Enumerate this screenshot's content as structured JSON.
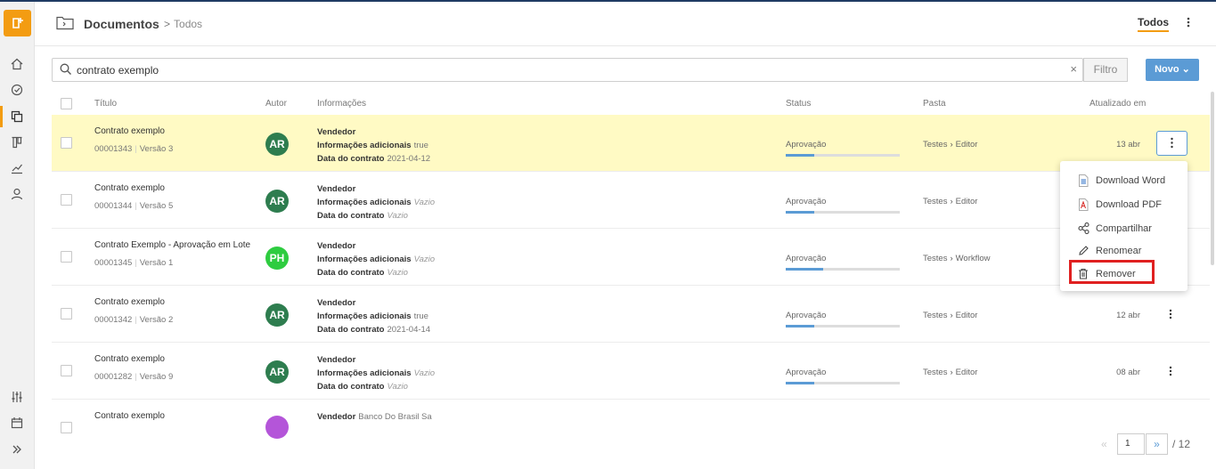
{
  "colors": {
    "accent": "#f39c12",
    "primary": "#5b9bd5",
    "highlight": "#fffac4",
    "danger": "#e02020"
  },
  "logo": {
    "glyph": "t",
    "icon": "add-document-logo"
  },
  "header": {
    "title": "Documentos",
    "breadcrumb": "Todos",
    "tab": "Todos"
  },
  "search": {
    "value": "contrato exemplo",
    "clear": "×"
  },
  "buttons": {
    "filtro": "Filtro",
    "novo": "Novo"
  },
  "columns": {
    "titulo": "Título",
    "autor": "Autor",
    "informacoes": "Informações",
    "status": "Status",
    "pasta": "Pasta",
    "atualizado": "Atualizado em"
  },
  "rows": [
    {
      "title": "Contrato exemplo",
      "code": "00001343",
      "version": "Versão 3",
      "author": "AR",
      "author_color": "#2e7d4f",
      "vendedor": "Vendedor",
      "vendedor_val": "",
      "info_label": "Informações adicionais",
      "info_val": "true",
      "data_label": "Data do contrato",
      "data_val": "2021-04-12",
      "status": "Aprovação",
      "progress": 0.25,
      "folder": "Testes",
      "subfolder": "Editor",
      "date": "13 abr"
    },
    {
      "title": "Contrato exemplo",
      "code": "00001344",
      "version": "Versão 5",
      "author": "AR",
      "author_color": "#2e7d4f",
      "vendedor": "Vendedor",
      "vendedor_val": "",
      "info_label": "Informações adicionais",
      "info_val": "Vazio",
      "data_label": "Data do contrato",
      "data_val": "Vazio",
      "status": "Aprovação",
      "progress": 0.25,
      "folder": "Testes",
      "subfolder": "Editor",
      "date": ""
    },
    {
      "title": "Contrato Exemplo - Aprovação em Lote",
      "code": "00001345",
      "version": "Versão 1",
      "author": "PH",
      "author_color": "#2ecc40",
      "vendedor": "Vendedor",
      "vendedor_val": "",
      "info_label": "Informações adicionais",
      "info_val": "Vazio",
      "data_label": "Data do contrato",
      "data_val": "Vazio",
      "status": "Aprovação",
      "progress": 0.33,
      "folder": "Testes",
      "subfolder": "Workflow",
      "date": ""
    },
    {
      "title": "Contrato exemplo",
      "code": "00001342",
      "version": "Versão 2",
      "author": "AR",
      "author_color": "#2e7d4f",
      "vendedor": "Vendedor",
      "vendedor_val": "",
      "info_label": "Informações adicionais",
      "info_val": "true",
      "data_label": "Data do contrato",
      "data_val": "2021-04-14",
      "status": "Aprovação",
      "progress": 0.25,
      "folder": "Testes",
      "subfolder": "Editor",
      "date": "12 abr"
    },
    {
      "title": "Contrato exemplo",
      "code": "00001282",
      "version": "Versão 9",
      "author": "AR",
      "author_color": "#2e7d4f",
      "vendedor": "Vendedor",
      "vendedor_val": "",
      "info_label": "Informações adicionais",
      "info_val": "Vazio",
      "data_label": "Data do contrato",
      "data_val": "Vazio",
      "status": "Aprovação",
      "progress": 0.25,
      "folder": "Testes",
      "subfolder": "Editor",
      "date": "08 abr"
    },
    {
      "title": "Contrato exemplo",
      "author_color": "#b455d9",
      "vendedor": "Vendedor",
      "vendedor_val": "Banco Do Brasil Sa"
    }
  ],
  "menu": {
    "items": [
      {
        "label": "Download Word",
        "icon": "word-file-icon"
      },
      {
        "label": "Download PDF",
        "icon": "pdf-file-icon"
      },
      {
        "label": "Compartilhar",
        "icon": "share-icon"
      },
      {
        "label": "Renomear",
        "icon": "pencil-icon"
      },
      {
        "label": "Remover",
        "icon": "trash-icon"
      }
    ]
  },
  "pagination": {
    "prev": "«",
    "current": "1",
    "next": "»",
    "total": "/ 12"
  }
}
